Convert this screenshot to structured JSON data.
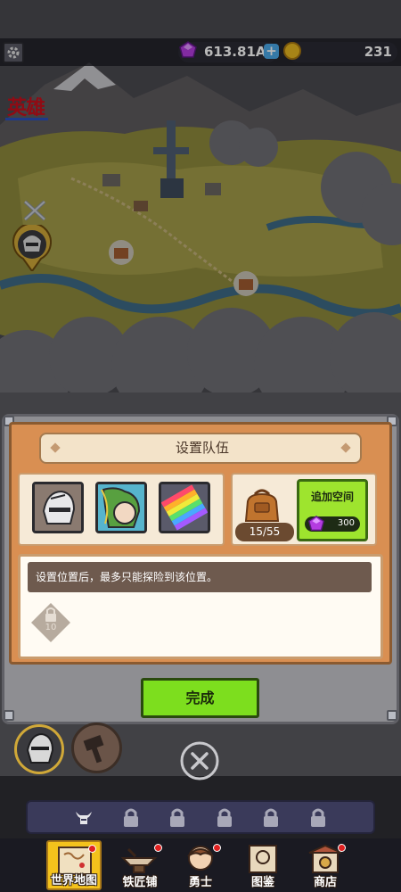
{
  "topbar": {
    "gems": "613.81A",
    "coins": "231",
    "icons": [
      "gear-icon",
      "gem-icon",
      "plus-icon",
      "coin-icon"
    ]
  },
  "watermark": "英雄",
  "map": {
    "markers": [
      "crossed-swords-icon",
      "hero-map-marker",
      "treasure-marker",
      "treasure-marker"
    ]
  },
  "panel": {
    "title": "设置队伍",
    "bag_count": "15/55",
    "add_space_label": "追加空间",
    "add_space_cost": "300",
    "message": "设置位置后，最多只能探险到该位置。",
    "locked_slot_level": "10",
    "done_label": "完成"
  },
  "slot_bar": {
    "icons": [
      "horned-helmet-icon",
      "lock-icon",
      "lock-icon",
      "lock-icon",
      "lock-icon",
      "lock-icon"
    ]
  },
  "nav": [
    {
      "label": "世界地图",
      "icon": "world-map-icon",
      "active": true
    },
    {
      "label": "铁匠铺",
      "icon": "blacksmith-icon",
      "active": false,
      "badge": true
    },
    {
      "label": "勇士",
      "icon": "warrior-icon",
      "active": false,
      "badge": true
    },
    {
      "label": "图鉴",
      "icon": "codex-icon",
      "active": false
    },
    {
      "label": "商店",
      "icon": "shop-icon",
      "active": false,
      "badge": true
    }
  ],
  "colors": {
    "panel_orange": "#d98f52",
    "done_green": "#7dde1e",
    "nav_active": "#f4c21c"
  }
}
